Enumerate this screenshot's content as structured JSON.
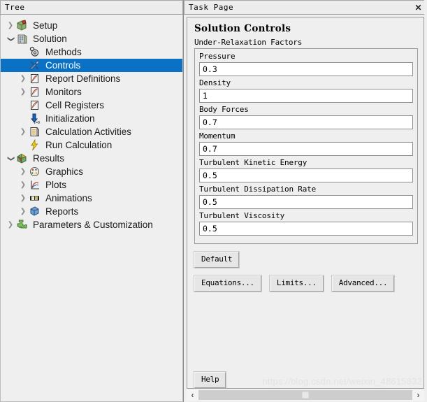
{
  "tree_panel": {
    "header_title": "Tree",
    "items": [
      {
        "label": "Setup",
        "level": 0,
        "expander": "collapsed",
        "icon": "setup-icon",
        "selected": false
      },
      {
        "label": "Solution",
        "level": 0,
        "expander": "expanded",
        "icon": "solution-icon",
        "selected": false
      },
      {
        "label": "Methods",
        "level": 1,
        "expander": "none",
        "icon": "methods-icon",
        "selected": false
      },
      {
        "label": "Controls",
        "level": 1,
        "expander": "none",
        "icon": "controls-icon",
        "selected": true
      },
      {
        "label": "Report Definitions",
        "level": 1,
        "expander": "collapsed",
        "icon": "report-icon",
        "selected": false
      },
      {
        "label": "Monitors",
        "level": 1,
        "expander": "collapsed",
        "icon": "report-icon",
        "selected": false
      },
      {
        "label": "Cell Registers",
        "level": 1,
        "expander": "none",
        "icon": "report-icon",
        "selected": false
      },
      {
        "label": "Initialization",
        "level": 1,
        "expander": "none",
        "icon": "initialization-icon",
        "selected": false
      },
      {
        "label": "Calculation Activities",
        "level": 1,
        "expander": "collapsed",
        "icon": "activities-icon",
        "selected": false
      },
      {
        "label": "Run Calculation",
        "level": 1,
        "expander": "none",
        "icon": "run-icon",
        "selected": false
      },
      {
        "label": "Results",
        "level": 0,
        "expander": "expanded",
        "icon": "results-icon",
        "selected": false
      },
      {
        "label": "Graphics",
        "level": 1,
        "expander": "collapsed",
        "icon": "graphics-icon",
        "selected": false
      },
      {
        "label": "Plots",
        "level": 1,
        "expander": "collapsed",
        "icon": "plots-icon",
        "selected": false
      },
      {
        "label": "Animations",
        "level": 1,
        "expander": "collapsed",
        "icon": "animations-icon",
        "selected": false
      },
      {
        "label": "Reports",
        "level": 1,
        "expander": "collapsed",
        "icon": "reports-icon",
        "selected": false
      },
      {
        "label": "Parameters & Customization",
        "level": 0,
        "expander": "collapsed",
        "icon": "parameters-icon",
        "selected": false
      }
    ],
    "selection_color": "#0b71c5"
  },
  "task_panel": {
    "header_title": "Task Page",
    "close_label": "✕",
    "title": "Solution Controls",
    "section_label": "Under-Relaxation Factors",
    "fields": [
      {
        "label": "Pressure",
        "value": "0.3"
      },
      {
        "label": "Density",
        "value": "1"
      },
      {
        "label": "Body Forces",
        "value": "0.7"
      },
      {
        "label": "Momentum",
        "value": "0.7"
      },
      {
        "label": "Turbulent Kinetic Energy",
        "value": "0.5"
      },
      {
        "label": "Turbulent Dissipation Rate",
        "value": "0.5"
      },
      {
        "label": "Turbulent Viscosity",
        "value": "0.5"
      }
    ],
    "default_button": "Default",
    "action_buttons": [
      {
        "label": "Equations..."
      },
      {
        "label": "Limits..."
      },
      {
        "label": "Advanced..."
      }
    ],
    "help_button": "Help",
    "scrollbar": {
      "left_arrow": "‹",
      "right_arrow": "›"
    }
  },
  "watermark": "https://blog.csdn.net/weixin_48615832"
}
